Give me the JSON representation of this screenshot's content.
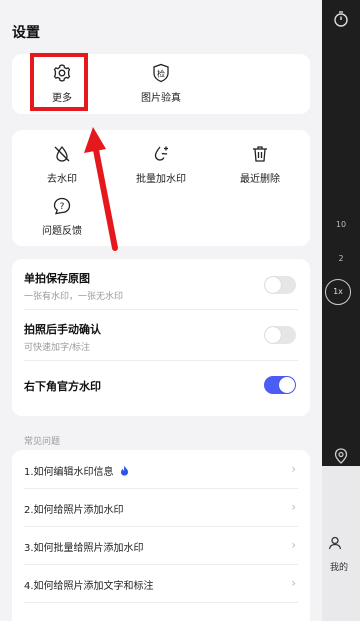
{
  "title": "设置",
  "top_card": {
    "items": [
      {
        "label": "更多",
        "icon": "gear-icon"
      },
      {
        "label": "图片验真",
        "icon": "verify-shield-icon",
        "icon_char": "检"
      }
    ]
  },
  "tools": {
    "items": [
      {
        "label": "去水印",
        "icon": "remove-watermark-icon"
      },
      {
        "label": "批量加水印",
        "icon": "batch-watermark-icon"
      },
      {
        "label": "最近删除",
        "icon": "trash-icon"
      },
      {
        "label": "问题反馈",
        "icon": "feedback-icon"
      }
    ]
  },
  "settings": [
    {
      "title": "单拍保存原图",
      "subtitle": "一张有水印，一张无水印",
      "on": false
    },
    {
      "title": "拍照后手动确认",
      "subtitle": "可快速加字/标注",
      "on": false
    },
    {
      "title": "右下角官方水印",
      "subtitle": "",
      "on": true
    }
  ],
  "faq_label": "常见问题",
  "faq": [
    {
      "label": "1.如何编辑水印信息",
      "hot": true
    },
    {
      "label": "2.如何给照片添加水印"
    },
    {
      "label": "3.如何批量给照片添加水印"
    },
    {
      "label": "4.如何给照片添加文字和标注"
    }
  ],
  "side": {
    "n10": "10",
    "n2": "2",
    "zoom": "1x",
    "bottom_label": "我的"
  },
  "colors": {
    "accent": "#4c5cf5",
    "highlight": "#e5191d"
  }
}
